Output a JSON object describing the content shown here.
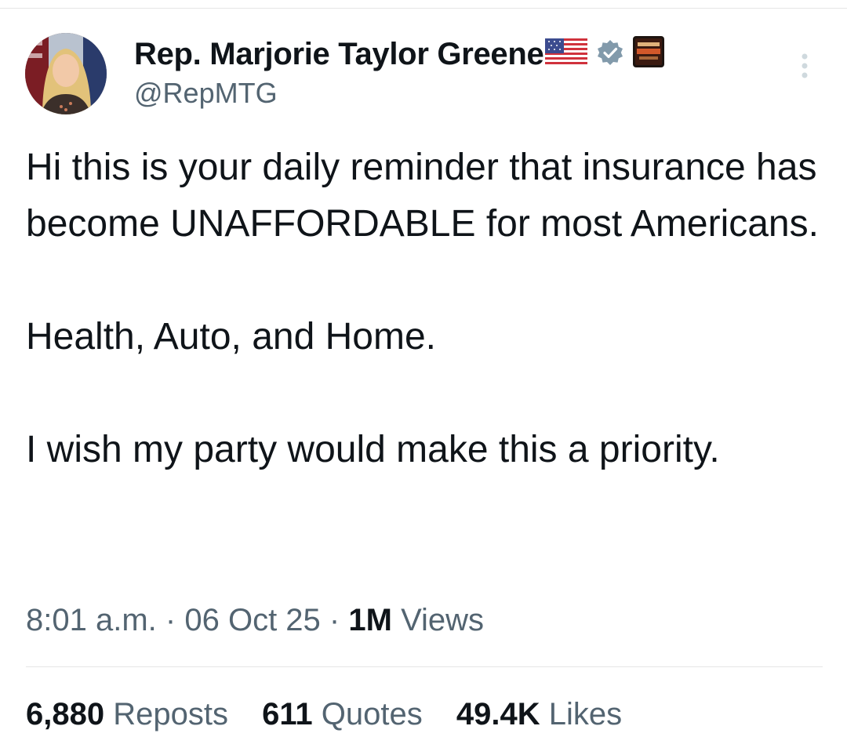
{
  "author": {
    "display_name": "Rep. Marjorie Taylor Greene",
    "handle": "@RepMTG",
    "flag_emoji_icon": "us-flag-icon",
    "verified_icon": "verified-badge-icon",
    "affiliate_icon": "affiliate-badge-icon",
    "verified_color": "#829aab"
  },
  "tweet": {
    "paragraphs": [
      "Hi this is your daily reminder that insurance has become UNAFFORDABLE for most Americans.",
      "Health, Auto, and Home.",
      "I wish my party would make this a priority."
    ],
    "time": "8:01 a.m.",
    "separator": "·",
    "date": "06 Oct 25",
    "views_count": "1M",
    "views_label": "Views"
  },
  "stats": {
    "reposts_count": "6,880",
    "reposts_label": "Reposts",
    "quotes_count": "611",
    "quotes_label": "Quotes",
    "likes_count": "49.4K",
    "likes_label": "Likes"
  },
  "colors": {
    "text_primary": "#0f1419",
    "text_secondary": "#536471",
    "divider": "#e6e6e6"
  }
}
